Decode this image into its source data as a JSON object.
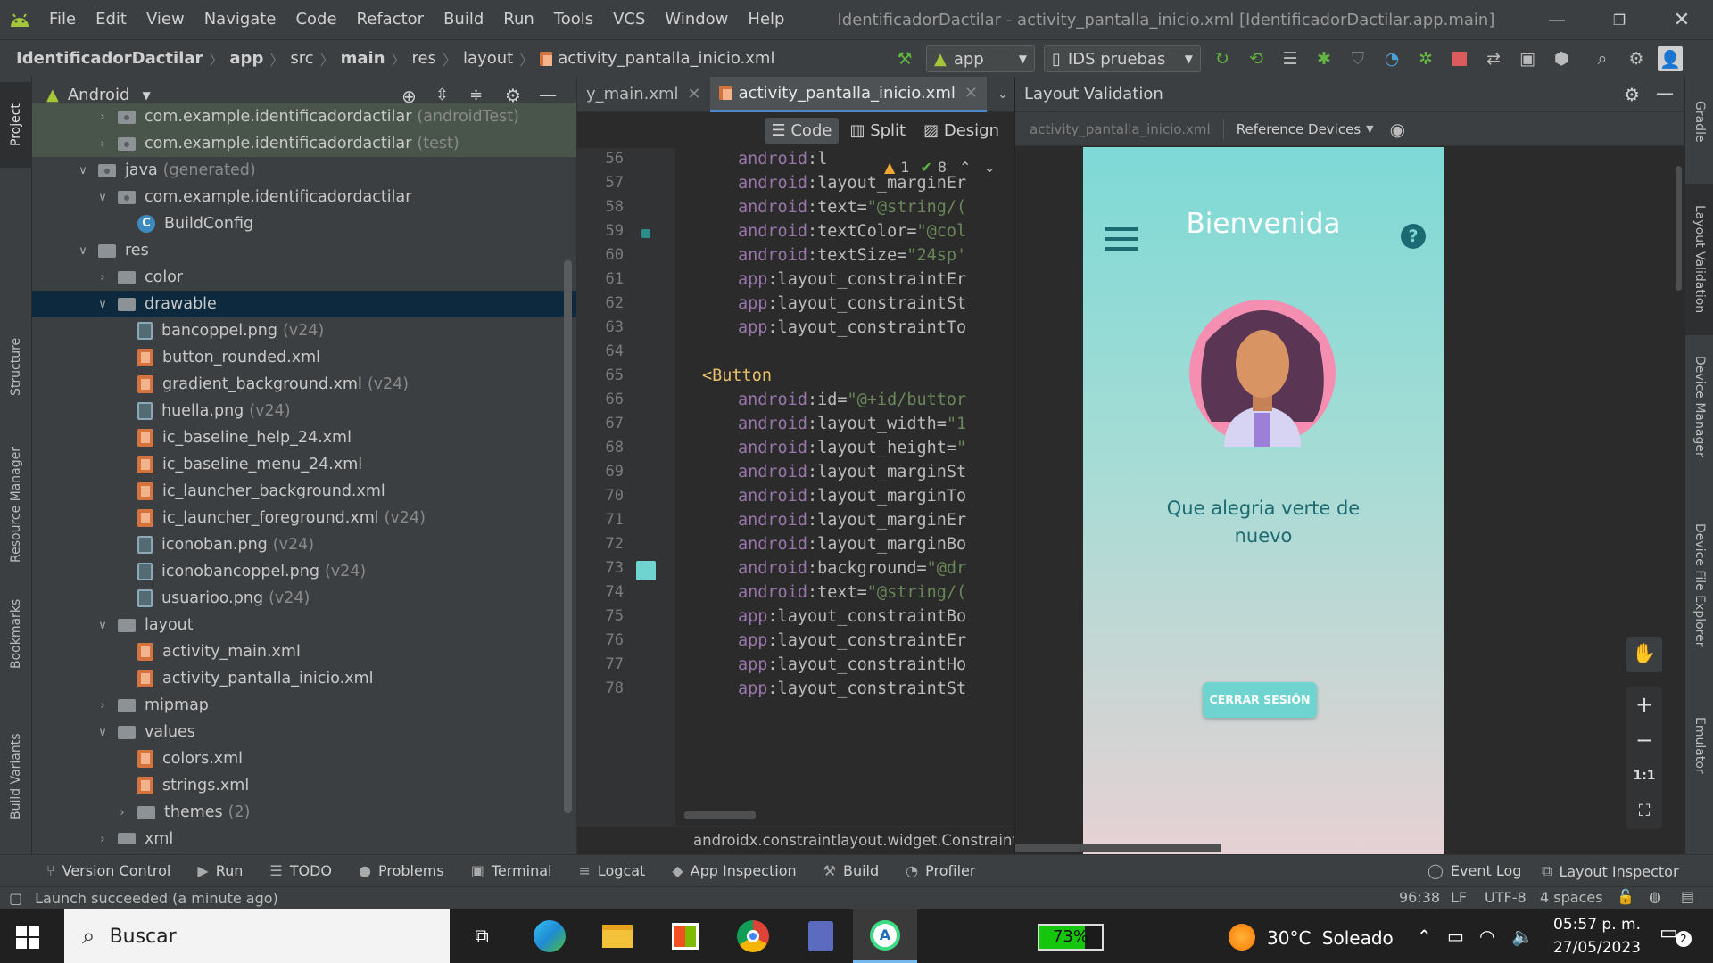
{
  "menubar": {
    "items": [
      "File",
      "Edit",
      "View",
      "Navigate",
      "Code",
      "Refactor",
      "Build",
      "Run",
      "Tools",
      "VCS",
      "Window",
      "Help"
    ],
    "title": "IdentificadorDactilar - activity_pantalla_inicio.xml [IdentificadorDactilar.app.main]"
  },
  "navbar": {
    "crumbs": [
      "IdentificadorDactilar",
      "app",
      "src",
      "main",
      "res",
      "layout",
      "activity_pantalla_inicio.xml"
    ],
    "run_config": "app",
    "device": "IDS pruebas"
  },
  "left_strip": [
    "Project",
    "Structure",
    "Resource Manager",
    "Bookmarks",
    "Build Variants"
  ],
  "right_strip": [
    "Gradle",
    "Layout Validation",
    "Device Manager",
    "Device File Explorer",
    "Emulator"
  ],
  "project": {
    "view": "Android",
    "tree": [
      {
        "label": "com.example.identificadordactilar",
        "suffix": "(androidTest)",
        "icon": "package",
        "indent": 0,
        "chev": "right",
        "hl": "test"
      },
      {
        "label": "com.example.identificadordactilar",
        "suffix": "(test)",
        "icon": "package",
        "indent": 0,
        "chev": "right",
        "hl": "test"
      },
      {
        "label": "java",
        "suffix": "(generated)",
        "icon": "folder-gen",
        "indent": -1,
        "chev": "down"
      },
      {
        "label": "com.example.identificadordactilar",
        "suffix": "",
        "icon": "package",
        "indent": 0,
        "chev": "down"
      },
      {
        "label": "BuildConfig",
        "suffix": "",
        "icon": "class",
        "indent": 1,
        "chev": ""
      },
      {
        "label": "res",
        "suffix": "",
        "icon": "res",
        "indent": -1,
        "chev": "down"
      },
      {
        "label": "color",
        "suffix": "",
        "icon": "folder",
        "indent": 0,
        "chev": "right"
      },
      {
        "label": "drawable",
        "suffix": "",
        "icon": "folder",
        "indent": 0,
        "chev": "down",
        "hl": "sel"
      },
      {
        "label": "bancoppel.png",
        "suffix": "(v24)",
        "icon": "png",
        "indent": 1,
        "chev": ""
      },
      {
        "label": "button_rounded.xml",
        "suffix": "",
        "icon": "xml",
        "indent": 1,
        "chev": ""
      },
      {
        "label": "gradient_background.xml",
        "suffix": "(v24)",
        "icon": "xml",
        "indent": 1,
        "chev": ""
      },
      {
        "label": "huella.png",
        "suffix": "(v24)",
        "icon": "png",
        "indent": 1,
        "chev": ""
      },
      {
        "label": "ic_baseline_help_24.xml",
        "suffix": "",
        "icon": "xml",
        "indent": 1,
        "chev": ""
      },
      {
        "label": "ic_baseline_menu_24.xml",
        "suffix": "",
        "icon": "xml",
        "indent": 1,
        "chev": ""
      },
      {
        "label": "ic_launcher_background.xml",
        "suffix": "",
        "icon": "xml",
        "indent": 1,
        "chev": ""
      },
      {
        "label": "ic_launcher_foreground.xml",
        "suffix": "(v24)",
        "icon": "xml",
        "indent": 1,
        "chev": ""
      },
      {
        "label": "iconoban.png",
        "suffix": "(v24)",
        "icon": "png",
        "indent": 1,
        "chev": ""
      },
      {
        "label": "iconobancoppel.png",
        "suffix": "(v24)",
        "icon": "png",
        "indent": 1,
        "chev": ""
      },
      {
        "label": "usuarioo.png",
        "suffix": "(v24)",
        "icon": "png",
        "indent": 1,
        "chev": ""
      },
      {
        "label": "layout",
        "suffix": "",
        "icon": "folder",
        "indent": 0,
        "chev": "down"
      },
      {
        "label": "activity_main.xml",
        "suffix": "",
        "icon": "xml",
        "indent": 1,
        "chev": ""
      },
      {
        "label": "activity_pantalla_inicio.xml",
        "suffix": "",
        "icon": "xml",
        "indent": 1,
        "chev": ""
      },
      {
        "label": "mipmap",
        "suffix": "",
        "icon": "folder",
        "indent": 0,
        "chev": "right"
      },
      {
        "label": "values",
        "suffix": "",
        "icon": "folder",
        "indent": 0,
        "chev": "down"
      },
      {
        "label": "colors.xml",
        "suffix": "",
        "icon": "xml",
        "indent": 1,
        "chev": ""
      },
      {
        "label": "strings.xml",
        "suffix": "",
        "icon": "xml",
        "indent": 1,
        "chev": ""
      },
      {
        "label": "themes",
        "suffix": "(2)",
        "icon": "folder",
        "indent": 1,
        "chev": "right"
      },
      {
        "label": "xml",
        "suffix": "",
        "icon": "folder",
        "indent": 0,
        "chev": "right"
      }
    ]
  },
  "editor": {
    "tabs": [
      "y_main.xml",
      "activity_pantalla_inicio.xml"
    ],
    "modes": [
      "Code",
      "Split",
      "Design"
    ],
    "inspections": {
      "warnings": "1",
      "ok": "8"
    },
    "lines": [
      {
        "n": "56",
        "parts": [
          [
            "an",
            "android"
          ],
          [
            "at",
            ":l"
          ]
        ]
      },
      {
        "n": "57",
        "parts": [
          [
            "an",
            "android"
          ],
          [
            "at",
            ":layout_marginEr"
          ]
        ]
      },
      {
        "n": "58",
        "parts": [
          [
            "an",
            "android"
          ],
          [
            "at",
            ":text="
          ],
          [
            "av",
            "\"@string/("
          ]
        ]
      },
      {
        "n": "59",
        "parts": [
          [
            "an",
            "android"
          ],
          [
            "at",
            ":textColor="
          ],
          [
            "av",
            "\"@col"
          ]
        ]
      },
      {
        "n": "60",
        "parts": [
          [
            "an",
            "android"
          ],
          [
            "at",
            ":textSize="
          ],
          [
            "av",
            "\"24sp'"
          ]
        ]
      },
      {
        "n": "61",
        "parts": [
          [
            "an",
            "app"
          ],
          [
            "at",
            ":layout_constraintEr"
          ]
        ]
      },
      {
        "n": "62",
        "parts": [
          [
            "an",
            "app"
          ],
          [
            "at",
            ":layout_constraintSt"
          ]
        ]
      },
      {
        "n": "63",
        "parts": [
          [
            "an",
            "app"
          ],
          [
            "at",
            ":layout_constraintTo"
          ]
        ]
      },
      {
        "n": "64",
        "parts": []
      },
      {
        "n": "65",
        "parts": [
          [
            "tg",
            "<Button"
          ]
        ],
        "indent": "tag"
      },
      {
        "n": "66",
        "parts": [
          [
            "an",
            "android"
          ],
          [
            "at",
            ":id="
          ],
          [
            "av",
            "\"@+id/buttor"
          ]
        ]
      },
      {
        "n": "67",
        "parts": [
          [
            "an",
            "android"
          ],
          [
            "at",
            ":layout_width="
          ],
          [
            "av",
            "\"1"
          ]
        ]
      },
      {
        "n": "68",
        "parts": [
          [
            "an",
            "android"
          ],
          [
            "at",
            ":layout_height="
          ],
          [
            "av",
            "\""
          ]
        ]
      },
      {
        "n": "69",
        "parts": [
          [
            "an",
            "android"
          ],
          [
            "at",
            ":layout_marginSt"
          ]
        ]
      },
      {
        "n": "70",
        "parts": [
          [
            "an",
            "android"
          ],
          [
            "at",
            ":layout_marginTo"
          ]
        ]
      },
      {
        "n": "71",
        "parts": [
          [
            "an",
            "android"
          ],
          [
            "at",
            ":layout_marginEr"
          ]
        ]
      },
      {
        "n": "72",
        "parts": [
          [
            "an",
            "android"
          ],
          [
            "at",
            ":layout_marginBo"
          ]
        ]
      },
      {
        "n": "73",
        "parts": [
          [
            "an",
            "android"
          ],
          [
            "at",
            ":background="
          ],
          [
            "av",
            "\"@dr"
          ]
        ]
      },
      {
        "n": "74",
        "parts": [
          [
            "an",
            "android"
          ],
          [
            "at",
            ":text="
          ],
          [
            "av",
            "\"@string/("
          ]
        ]
      },
      {
        "n": "75",
        "parts": [
          [
            "an",
            "app"
          ],
          [
            "at",
            ":layout_constraintBo"
          ]
        ]
      },
      {
        "n": "76",
        "parts": [
          [
            "an",
            "app"
          ],
          [
            "at",
            ":layout_constraintEr"
          ]
        ]
      },
      {
        "n": "77",
        "parts": [
          [
            "an",
            "app"
          ],
          [
            "at",
            ":layout_constraintHo"
          ]
        ]
      },
      {
        "n": "78",
        "parts": [
          [
            "an",
            "app"
          ],
          [
            "at",
            ":layout_constraintSt"
          ]
        ]
      }
    ],
    "status": "androidx.constraintlayout.widget.ConstraintLa"
  },
  "layout_validation": {
    "title": "Layout Validation",
    "file": "activity_pantalla_inicio.xml",
    "devices": "Reference Devices",
    "preview": {
      "title": "Bienvenida",
      "subtitle": "Que alegria verte de nuevo",
      "button": "CERRAR SESIÓN"
    },
    "zoom": [
      "+",
      "−",
      "1:1"
    ]
  },
  "bottom_tools": [
    "Version Control",
    "Run",
    "TODO",
    "Problems",
    "Terminal",
    "Logcat",
    "App Inspection",
    "Build",
    "Profiler"
  ],
  "bottom_right": [
    "Event Log",
    "Layout Inspector"
  ],
  "status": {
    "message": "Launch succeeded (a minute ago)",
    "pos": "96:38",
    "eol": "LF",
    "enc": "UTF-8",
    "indent": "4 spaces"
  },
  "taskbar": {
    "search": "Buscar",
    "battery": "73%",
    "weather_temp": "30°C",
    "weather_desc": "Soleado",
    "time": "05:57 p. m.",
    "date": "27/05/2023",
    "notifications": "2"
  },
  "colors": {
    "accent": "#4a88c7",
    "android_green": "#a4c639",
    "teal": "#6fd4cf"
  }
}
